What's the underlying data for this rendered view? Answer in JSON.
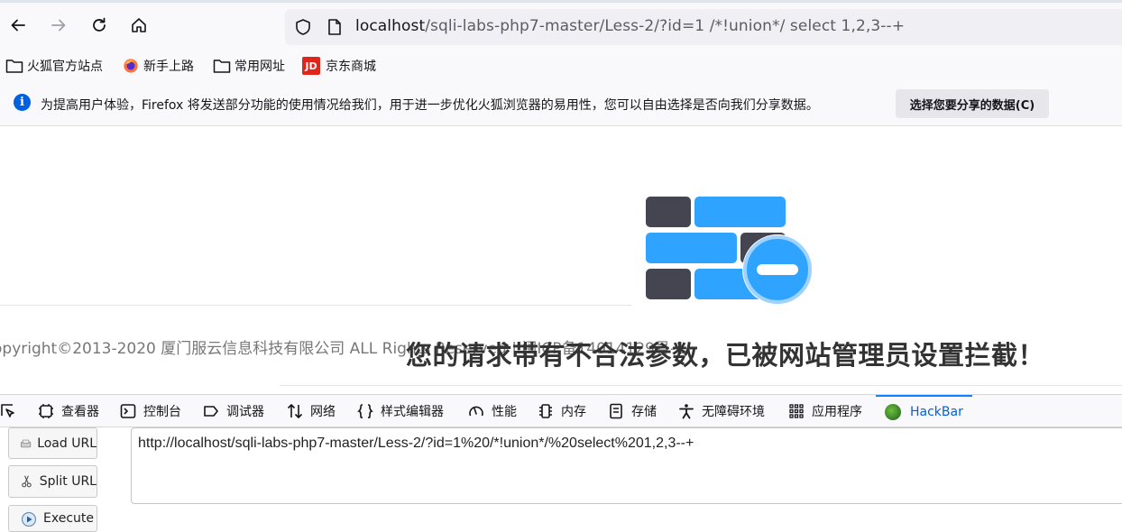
{
  "browser": {
    "url_host": "localhost",
    "url_rest": "/sqli-labs-php7-master/Less-2/?id=1 /*!union*/ select 1,2,3--+",
    "nav_icons": [
      "back-icon",
      "forward-icon",
      "reload-icon",
      "home-icon"
    ]
  },
  "bookmarks": [
    {
      "label": "火狐官方站点",
      "icon": "folder-icon"
    },
    {
      "label": "新手上路",
      "icon": "firefox-icon"
    },
    {
      "label": "常用网址",
      "icon": "folder-icon"
    },
    {
      "label": "京东商城",
      "icon": "jd-icon",
      "badge": "JD"
    }
  ],
  "notification": {
    "message": "为提高用户体验，Firefox 将发送部分功能的使用情况给我们，用于进一步优化火狐浏览器的易用性，您可以自由选择是否向我们分享数据。",
    "button": "选择您要分享的数据(C)"
  },
  "page": {
    "copyright": "opyright©2013-2020 厦门服云信息科技有限公司 ALL Rights Reserved | 闽ICP备14014129号-1",
    "blocked_message": "您的请求带有不合法参数，已被网站管理员设置拦截！"
  },
  "devtools": {
    "tabs": [
      "查看器",
      "控制台",
      "调试器",
      "网络",
      "样式编辑器",
      "性能",
      "内存",
      "存储",
      "无障碍环境",
      "应用程序",
      "HackBar"
    ],
    "active_tab": "HackBar"
  },
  "hackbar": {
    "load_url": "Load URL",
    "split_url": "Split URL",
    "execute": "Execute",
    "url_value": "http://localhost/sqli-labs-php7-master/Less-2/?id=1%20/*!union*/%20select%201,2,3--+"
  },
  "colors": {
    "accent": "#0060df",
    "wall_blue": "#2ea3ff",
    "wall_dark": "#454552"
  }
}
